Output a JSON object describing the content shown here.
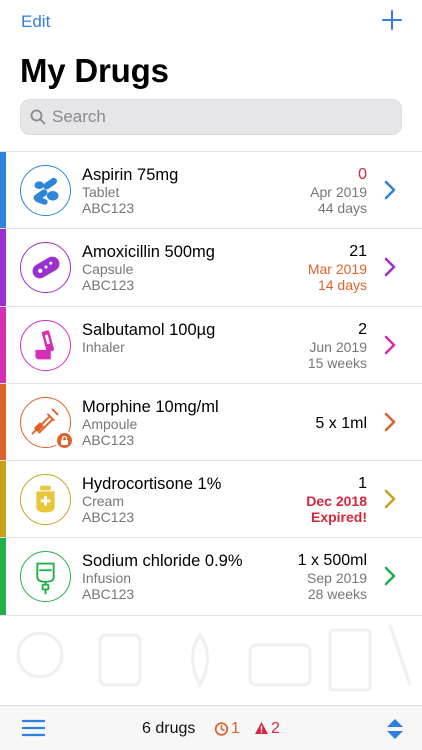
{
  "nav": {
    "edit_label": "Edit",
    "add_icon": "plus-icon",
    "accent": "#2f7fe0"
  },
  "title": "My Drugs",
  "search": {
    "placeholder": "Search",
    "icon": "search-icon"
  },
  "drugs": [
    {
      "name": "Aspirin 75mg",
      "form": "Tablet",
      "code": "ABC123",
      "quantity": "0",
      "expiry": "Apr 2019",
      "remaining": "44 days",
      "color": "#2f86d8",
      "icon": "tablets-icon",
      "qty_color": "#d6253c",
      "expiry_color": "#777777",
      "remaining_color": "#777777"
    },
    {
      "name": "Amoxicillin 500mg",
      "form": "Capsule",
      "code": "ABC123",
      "quantity": "21",
      "expiry": "Mar 2019",
      "remaining": "14 days",
      "color": "#9c2fd0",
      "icon": "capsule-icon",
      "qty_color": "#000000",
      "expiry_color": "#e0622b",
      "remaining_color": "#e0622b"
    },
    {
      "name": "Salbutamol 100µg",
      "form": "Inhaler",
      "code": "",
      "quantity": "2",
      "expiry": "Jun 2019",
      "remaining": "15 weeks",
      "color": "#d62fb6",
      "icon": "inhaler-icon",
      "qty_color": "#000000",
      "expiry_color": "#777777",
      "remaining_color": "#777777"
    },
    {
      "name": "Morphine 10mg/ml",
      "form": "Ampoule",
      "code": "ABC123",
      "quantity": "5 x 1ml",
      "expiry": "",
      "remaining": "",
      "color": "#e0622b",
      "icon": "ampoule-icon",
      "badge": "lock-icon",
      "qty_color": "#000000",
      "expiry_color": "#777777",
      "remaining_color": "#777777"
    },
    {
      "name": "Hydrocortisone 1%",
      "form": "Cream",
      "code": "ABC123",
      "quantity": "1",
      "expiry": "Dec 2018",
      "remaining": "Expired!",
      "color": "#c9a21c",
      "icon": "cream-tube-icon",
      "qty_color": "#000000",
      "expiry_color": "#d6253c",
      "remaining_color": "#d6253c"
    },
    {
      "name": "Sodium chloride 0.9%",
      "form": "Infusion",
      "code": "ABC123",
      "quantity": "1 x 500ml",
      "expiry": "Sep 2019",
      "remaining": "28 weeks",
      "color": "#23b04a",
      "icon": "infusion-bag-icon",
      "qty_color": "#000000",
      "expiry_color": "#777777",
      "remaining_color": "#777777"
    }
  ],
  "toolbar": {
    "menu_icon": "hamburger-icon",
    "drug_count": "6 drugs",
    "expiring_count": "1",
    "expiring_icon": "timer-icon",
    "expiring_color": "#e0622b",
    "expired_count": "2",
    "expired_icon": "warning-icon",
    "expired_color": "#d6253c",
    "sort_icon": "sort-arrows-icon"
  }
}
